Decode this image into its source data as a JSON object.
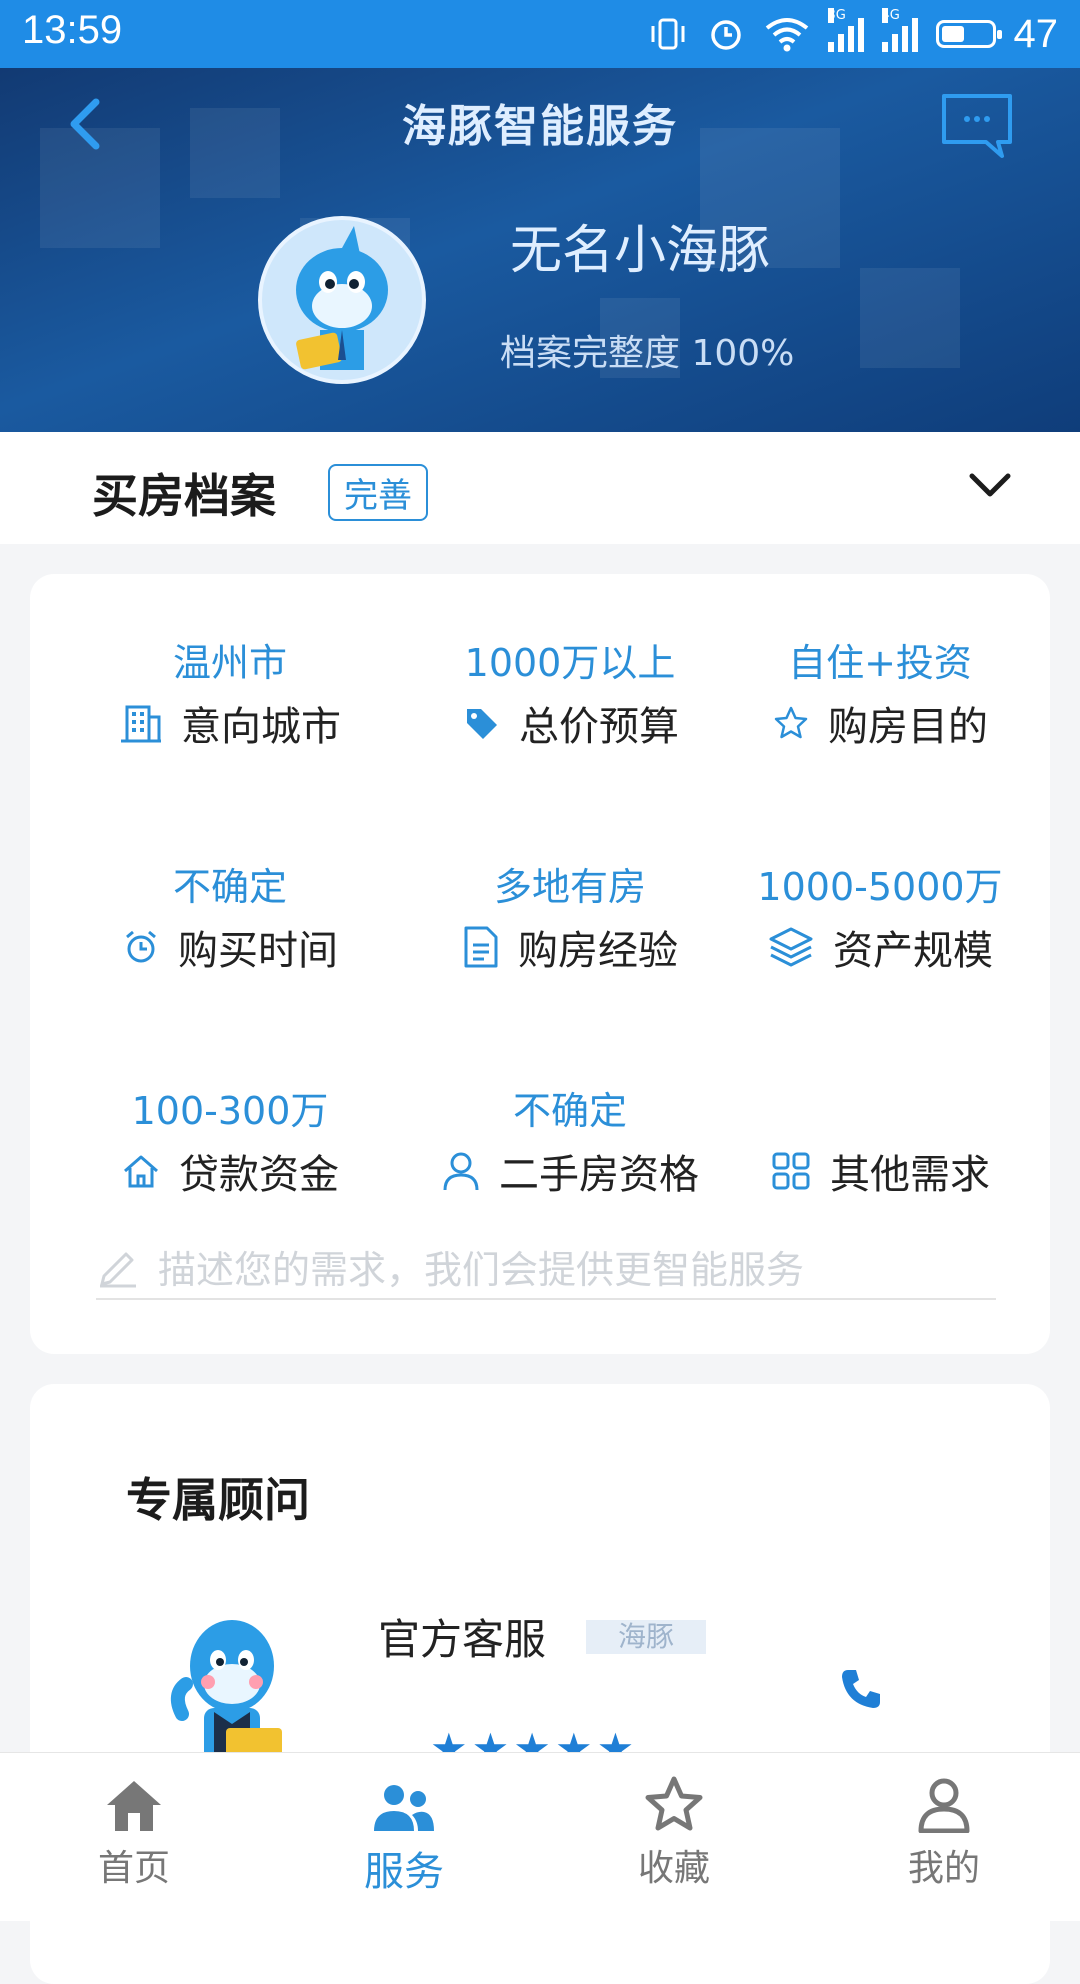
{
  "status_bar": {
    "time": "13:59",
    "battery": "47",
    "battery_level": 0.47,
    "net_3g": "3G",
    "net_4g": "4G"
  },
  "header": {
    "title": "海豚智能服务",
    "user_name": "无名小海豚",
    "completeness": "档案完整度 100%"
  },
  "profile": {
    "title": "买房档案",
    "edit_badge": "完善",
    "items": [
      {
        "value": "温州市",
        "label": "意向城市",
        "icon": "building-icon"
      },
      {
        "value": "1000万以上",
        "label": "总价预算",
        "icon": "price-tag-icon"
      },
      {
        "value": "自住+投资",
        "label": "购房目的",
        "icon": "star-icon"
      },
      {
        "value": "不确定",
        "label": "购买时间",
        "icon": "alarm-clock-icon"
      },
      {
        "value": "多地有房",
        "label": "购房经验",
        "icon": "document-icon"
      },
      {
        "value": "1000-5000万",
        "label": "资产规模",
        "icon": "layers-icon"
      },
      {
        "value": "100-300万",
        "label": "贷款资金",
        "icon": "house-icon"
      },
      {
        "value": "不确定",
        "label": "二手房资格",
        "icon": "person-icon"
      },
      {
        "value": "",
        "label": "其他需求",
        "icon": "grid-icon"
      }
    ],
    "description_placeholder": "描述您的需求，我们会提供更智能服务"
  },
  "advisor": {
    "section_title": "专属顾问",
    "name": "官方客服",
    "tag": "海豚",
    "stars": "★★★★★",
    "rating": 5
  },
  "tabbar": {
    "tabs": [
      {
        "label": "首页",
        "icon": "home-icon"
      },
      {
        "label": "服务",
        "icon": "service-icon"
      },
      {
        "label": "收藏",
        "icon": "favorite-star-icon"
      },
      {
        "label": "我的",
        "icon": "profile-icon"
      }
    ],
    "active_index": 1
  },
  "colors": {
    "accent": "#2b8fd8",
    "status_bar": "#1f8ce6",
    "header_dark": "#123a73"
  }
}
